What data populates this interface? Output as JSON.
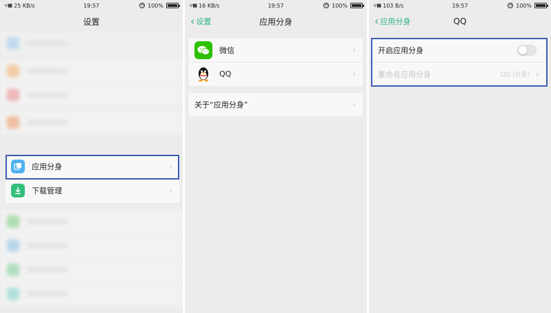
{
  "screens": [
    {
      "status": {
        "network": "25 KB/s",
        "time": "19:57",
        "battery": "100%"
      },
      "title": "设置",
      "items": [
        {
          "label": "应用分身",
          "icon": "app-clone-icon",
          "color": "#4fb2f0"
        },
        {
          "label": "下载管理",
          "icon": "download-icon",
          "color": "#33bf7c"
        }
      ]
    },
    {
      "status": {
        "network": "16 KB/s",
        "time": "19:57",
        "battery": "100%"
      },
      "back": "设置",
      "title": "应用分身",
      "apps": [
        {
          "label": "微信",
          "icon": "wechat-icon"
        },
        {
          "label": "QQ",
          "icon": "qq-icon"
        }
      ],
      "about": "关于“应用分身”"
    },
    {
      "status": {
        "network": "103 B/s",
        "time": "19:57",
        "battery": "100%"
      },
      "back": "应用分身",
      "title": "QQ",
      "toggle_label": "开启应用分身",
      "toggle_on": false,
      "rename_label": "重命名应用分身",
      "rename_value": "QQ (分身)"
    }
  ],
  "colors": {
    "accent": "#2fb28a",
    "highlight": "#3d5bb5"
  }
}
